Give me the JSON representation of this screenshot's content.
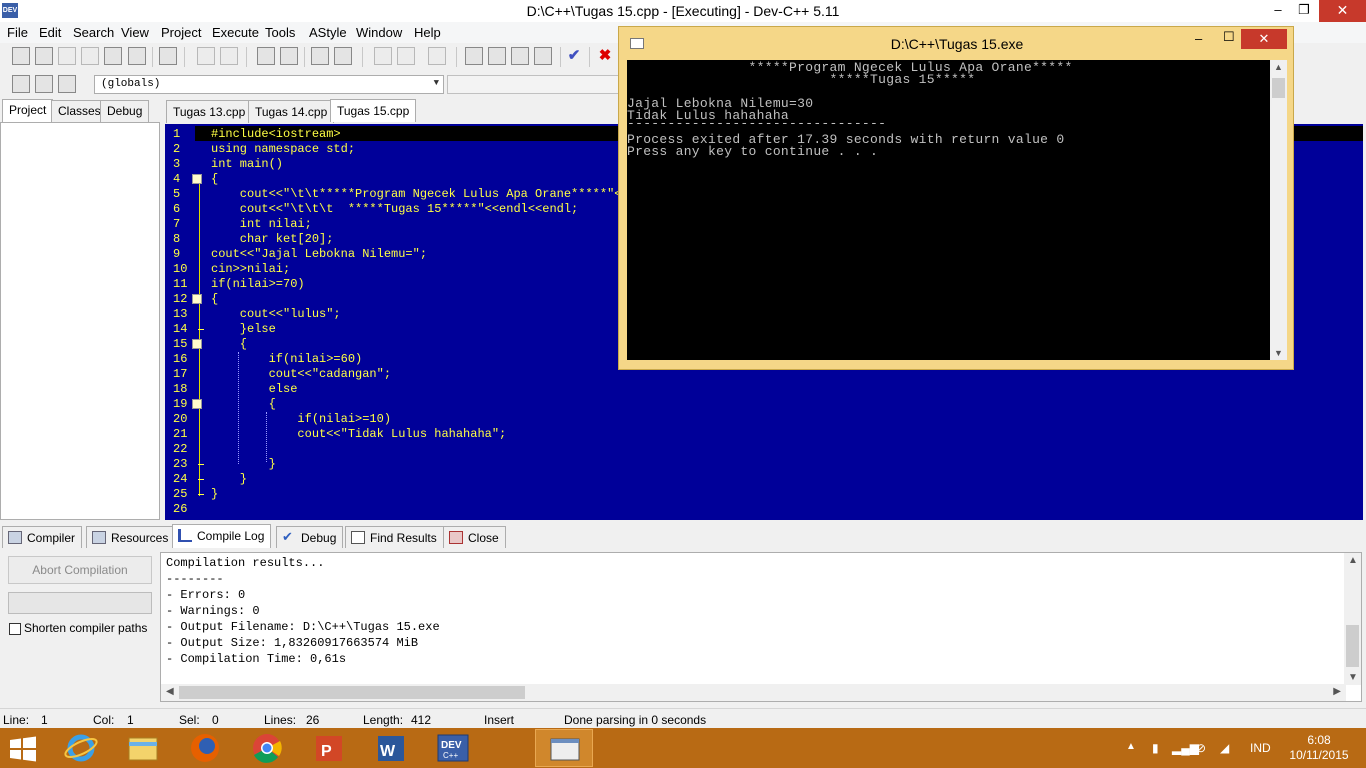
{
  "window": {
    "title": "D:\\C++\\Tugas 15.cpp - [Executing] - Dev-C++ 5.11",
    "app_icon_text": "DEV",
    "minimize": "–",
    "restore": "❐",
    "close": "✕"
  },
  "menu": [
    "File",
    "Edit",
    "Search",
    "View",
    "Project",
    "Execute",
    "Tools",
    "AStyle",
    "Window",
    "Help"
  ],
  "scope_select": "(globals)",
  "left_tabs": [
    "Project",
    "Classes",
    "Debug"
  ],
  "file_tabs": [
    "Tugas 13.cpp",
    "Tugas 14.cpp",
    "Tugas 15.cpp"
  ],
  "active_file_tab": "Tugas 15.cpp",
  "code_lines": [
    "#include<iostream>",
    "using namespace std;",
    "int main()",
    "{",
    "    cout<<\"\\t\\t*****Program Ngecek Lulus Apa Orane*****\"<<",
    "    cout<<\"\\t\\t\\t  *****Tugas 15*****\"<<endl<<endl;",
    "    int nilai;",
    "    char ket[20];",
    "cout<<\"Jajal Lebokna Nilemu=\";",
    "cin>>nilai;",
    "if(nilai>=70)",
    "{",
    "    cout<<\"lulus\";",
    "    }else",
    "    {",
    "        if(nilai>=60)",
    "        cout<<\"cadangan\";",
    "        else",
    "        {",
    "            if(nilai>=10)",
    "            cout<<\"Tidak Lulus hahahaha\";",
    "",
    "        }",
    "    }",
    "}",
    ""
  ],
  "line_numbers": [
    "1",
    "2",
    "3",
    "4",
    "5",
    "6",
    "7",
    "8",
    "9",
    "10",
    "11",
    "12",
    "13",
    "14",
    "15",
    "16",
    "17",
    "18",
    "19",
    "20",
    "21",
    "22",
    "23",
    "24",
    "25",
    "26"
  ],
  "console": {
    "title": "D:\\C++\\Tugas 15.exe",
    "minimize": "–",
    "maximize": "☐",
    "close": "✕",
    "lines": [
      "               *****Program Ngecek Lulus Apa Orane*****",
      "                         *****Tugas 15*****",
      "",
      "Jajal Lebokna Nilemu=30",
      "Tidak Lulus hahahaha",
      "--------------------------------",
      "Process exited after 17.39 seconds with return value 0",
      "Press any key to continue . . ."
    ]
  },
  "bottom_tabs": [
    "Compiler",
    "Resources",
    "Compile Log",
    "Debug",
    "Find Results",
    "Close"
  ],
  "active_bottom_tab": "Compile Log",
  "abort_button": "Abort Compilation",
  "shorten_paths_label": "Shorten compiler paths",
  "shorten_paths_checked": false,
  "compile_log": [
    "Compilation results...",
    "--------",
    "- Errors: 0",
    "- Warnings: 0",
    "- Output Filename: D:\\C++\\Tugas 15.exe",
    "- Output Size: 1,83260917663574 MiB",
    "- Compilation Time: 0,61s"
  ],
  "status": {
    "line_label": "Line:",
    "line_value": "1",
    "col_label": "Col:",
    "col_value": "1",
    "sel_label": "Sel:",
    "sel_value": "0",
    "lines_label": "Lines:",
    "lines_value": "26",
    "length_label": "Length:",
    "length_value": "412",
    "mode": "Insert",
    "message": "Done parsing in 0 seconds"
  },
  "taskbar": {
    "apps": [
      "file-explorer",
      "internet-explorer",
      "firefox",
      "chrome",
      "powerpoint",
      "word",
      "dev-cpp",
      "console-window"
    ],
    "language": "IND",
    "time": "6:08",
    "date": "10/11/2015"
  },
  "colors": {
    "editor_bg": "#000099",
    "editor_text": "#ffff44",
    "console_frame": "#f5d788",
    "close_red": "#c7392b",
    "taskbar": "#b86a14"
  }
}
